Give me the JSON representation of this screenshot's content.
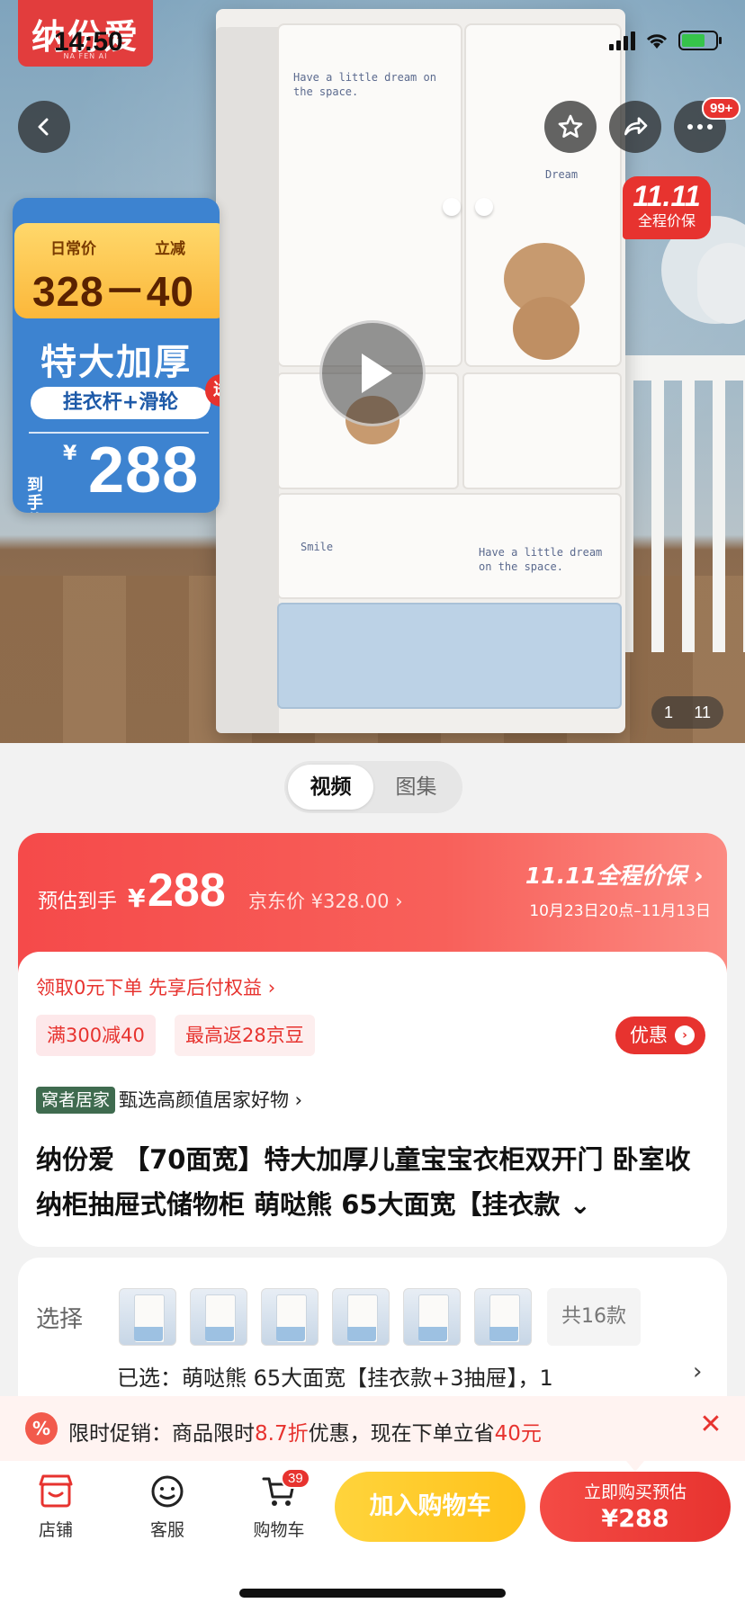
{
  "status_bar": {
    "time": "14:50"
  },
  "brand": {
    "logo_text": "纳份爱",
    "logo_sub": "NA FEN AI"
  },
  "hero": {
    "more_badge": "99+",
    "promo_badge_big": "11.11",
    "promo_badge_small": "全程价保",
    "wardrobe_text_1": "Have a little dream on the space.",
    "wardrobe_text_2": "Dream",
    "wardrobe_text_3": "Smile",
    "wardrobe_text_4": "Have a little dream on the space.",
    "price_card": {
      "daily_label": "日常价",
      "discount_label": "立减",
      "formula": "328－40",
      "headline": "特大加厚",
      "gift_pill": "挂衣杆+滑轮",
      "gift_badge": "送",
      "final_label": "到手价",
      "final_symbol": "¥",
      "final_price": "288"
    },
    "page_current": "1",
    "page_total": "11"
  },
  "media_toggle": {
    "video": "视频",
    "gallery": "图集"
  },
  "price_banner": {
    "est_label": "预估到手",
    "yen": "¥",
    "price": "288",
    "jd_price": "京东价 ¥328.00 ›",
    "promo_title": "11.11全程价保 ›",
    "promo_date": "10月23日20点–11月13日"
  },
  "pay_later": "领取0元下单 先享后付权益 ›",
  "coupons": [
    "满300减40",
    "最高返28京豆"
  ],
  "discount_button": {
    "label": "优惠",
    "arrow": "›"
  },
  "category": {
    "tag": "窝者居家",
    "text": "甄选高颜值居家好物 ›"
  },
  "product_title": "纳份爱 【70面宽】特大加厚儿童宝宝衣柜双开门 卧室收纳柜抽屉式储物柜 萌哒熊 65大面宽【挂衣款 ⌄",
  "selection": {
    "label": "选择",
    "total_styles": "共16款",
    "selected": "已选：萌哒熊 65大面宽【挂衣款+3抽屉】，1",
    "chevron": "›"
  },
  "promo_bar": {
    "icon": "%",
    "text_1": "限时促销：商品限时",
    "discount": "8.7折",
    "text_2": "优惠，现在下单立省",
    "save": "40元",
    "close": "✕"
  },
  "bottom_nav": {
    "store": "店铺",
    "service": "客服",
    "cart": "购物车",
    "cart_badge": "39",
    "add_to_cart": "加入购物车",
    "buy_now_line1": "立即购买预估",
    "buy_now_line2": "¥288"
  },
  "colors": {
    "accent": "#e7332f",
    "yellow": "#ffc21a",
    "blue": "#3d83d0"
  }
}
